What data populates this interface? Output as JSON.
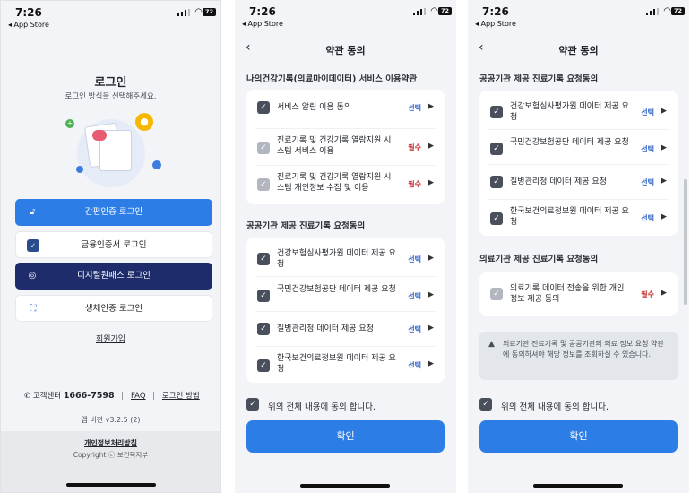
{
  "status": {
    "time": "7:26",
    "back_app": "◂ App Store",
    "battery": "72"
  },
  "login": {
    "title": "로그인",
    "subtitle": "로그인 방식을 선택해주세요.",
    "buttons": [
      {
        "label": "간편인증 로그인"
      },
      {
        "label": "금융인증서 로그인"
      },
      {
        "label": "디지털원패스 로그인"
      },
      {
        "label": "생체인증 로그인"
      }
    ],
    "signup": "회원가입",
    "support_label": "고객센터",
    "support_number": "1666-7598",
    "faq": "FAQ",
    "login_help": "로그인 방법",
    "version": "앱 버전 v3.2.5 (2)",
    "privacy": "개인정보처리방침",
    "copyright": "Copyright ⓒ 보건복지부"
  },
  "terms1": {
    "nav_title": "약관 동의",
    "section1_title": "나의건강기록(의료마이데이터) 서비스 이용약관",
    "section1_items": [
      {
        "text": "서비스 알림 이용 동의",
        "tag": "선택"
      },
      {
        "text": "진료기록 및 건강기록 열람지원 시스템 서비스 이용",
        "tag": "필수"
      },
      {
        "text": "진료기록 및 건강기록 열람지원 시스템 개인정보 수집 및 이용",
        "tag": "필수"
      }
    ],
    "section2_title": "공공기관 제공 진료기록 요청동의",
    "section2_items": [
      {
        "text": "건강보험심사평가원 데이터 제공 요청",
        "tag": "선택"
      },
      {
        "text": "국민건강보험공단 데이터 제공 요청",
        "tag": "선택"
      },
      {
        "text": "질병관리청 데이터 제공 요청",
        "tag": "선택"
      },
      {
        "text": "한국보건의료정보원 데이터 제공 요청",
        "tag": "선택"
      }
    ],
    "agree_all": "위의 전체 내용에 동의 합니다.",
    "confirm": "확인"
  },
  "terms2": {
    "nav_title": "약관 동의",
    "section1_title": "공공기관 제공 진료기록 요청동의",
    "section1_items": [
      {
        "text": "건강보험심사평가원 데이터 제공 요청",
        "tag": "선택"
      },
      {
        "text": "국민건강보험공단 데이터 제공 요청",
        "tag": "선택"
      },
      {
        "text": "질병관리청 데이터 제공 요청",
        "tag": "선택"
      },
      {
        "text": "한국보건의료정보원 데이터 제공 요청",
        "tag": "선택"
      }
    ],
    "section2_title": "의료기관 제공 진료기록 요청동의",
    "section2_items": [
      {
        "text": "의료기록 데이터 전송을 위한 개인정보 제공 동의",
        "tag": "필수"
      }
    ],
    "notice": "의료기관 진료기록 및 공공기관의 의료 정보 요청 약관에 동의하셔야 해당 정보를 조회하실 수 있습니다.",
    "agree_all": "위의 전체 내용에 동의 합니다.",
    "confirm": "확인"
  }
}
